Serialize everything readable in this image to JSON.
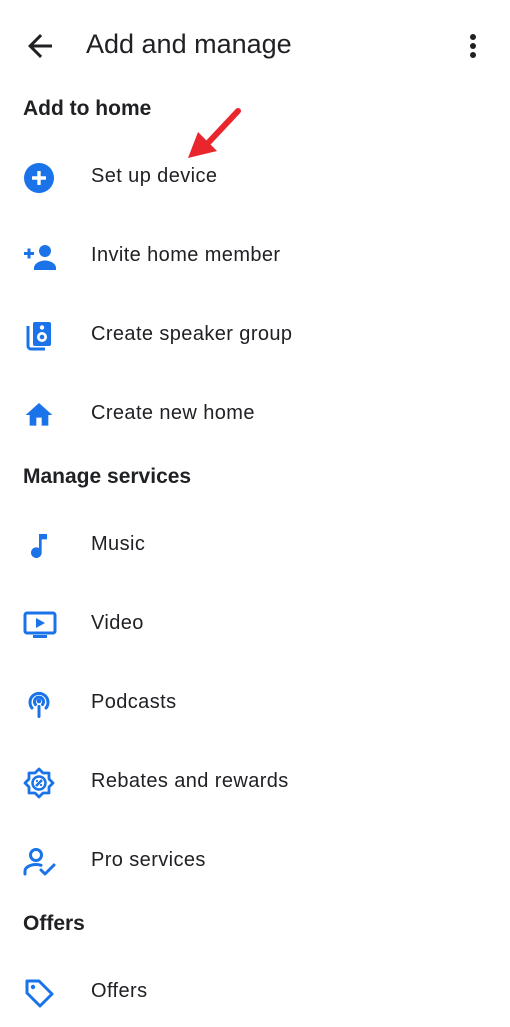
{
  "header": {
    "title": "Add and manage"
  },
  "sections": {
    "add_to_home": {
      "title": "Add to home",
      "items": [
        {
          "label": "Set up device",
          "icon": "add-circle-icon"
        },
        {
          "label": "Invite home member",
          "icon": "person-add-icon"
        },
        {
          "label": "Create speaker group",
          "icon": "speaker-group-icon"
        },
        {
          "label": "Create new home",
          "icon": "home-icon"
        }
      ]
    },
    "manage_services": {
      "title": "Manage services",
      "items": [
        {
          "label": "Music",
          "icon": "music-note-icon"
        },
        {
          "label": "Video",
          "icon": "video-play-icon"
        },
        {
          "label": "Podcasts",
          "icon": "podcast-icon"
        },
        {
          "label": "Rebates and rewards",
          "icon": "rebates-icon"
        },
        {
          "label": "Pro services",
          "icon": "pro-services-icon"
        }
      ]
    },
    "offers": {
      "title": "Offers",
      "items": [
        {
          "label": "Offers",
          "icon": "tag-icon"
        }
      ]
    }
  },
  "colors": {
    "accent": "#1a73e8",
    "text": "#202124",
    "annotation_arrow": "#e8262c"
  }
}
